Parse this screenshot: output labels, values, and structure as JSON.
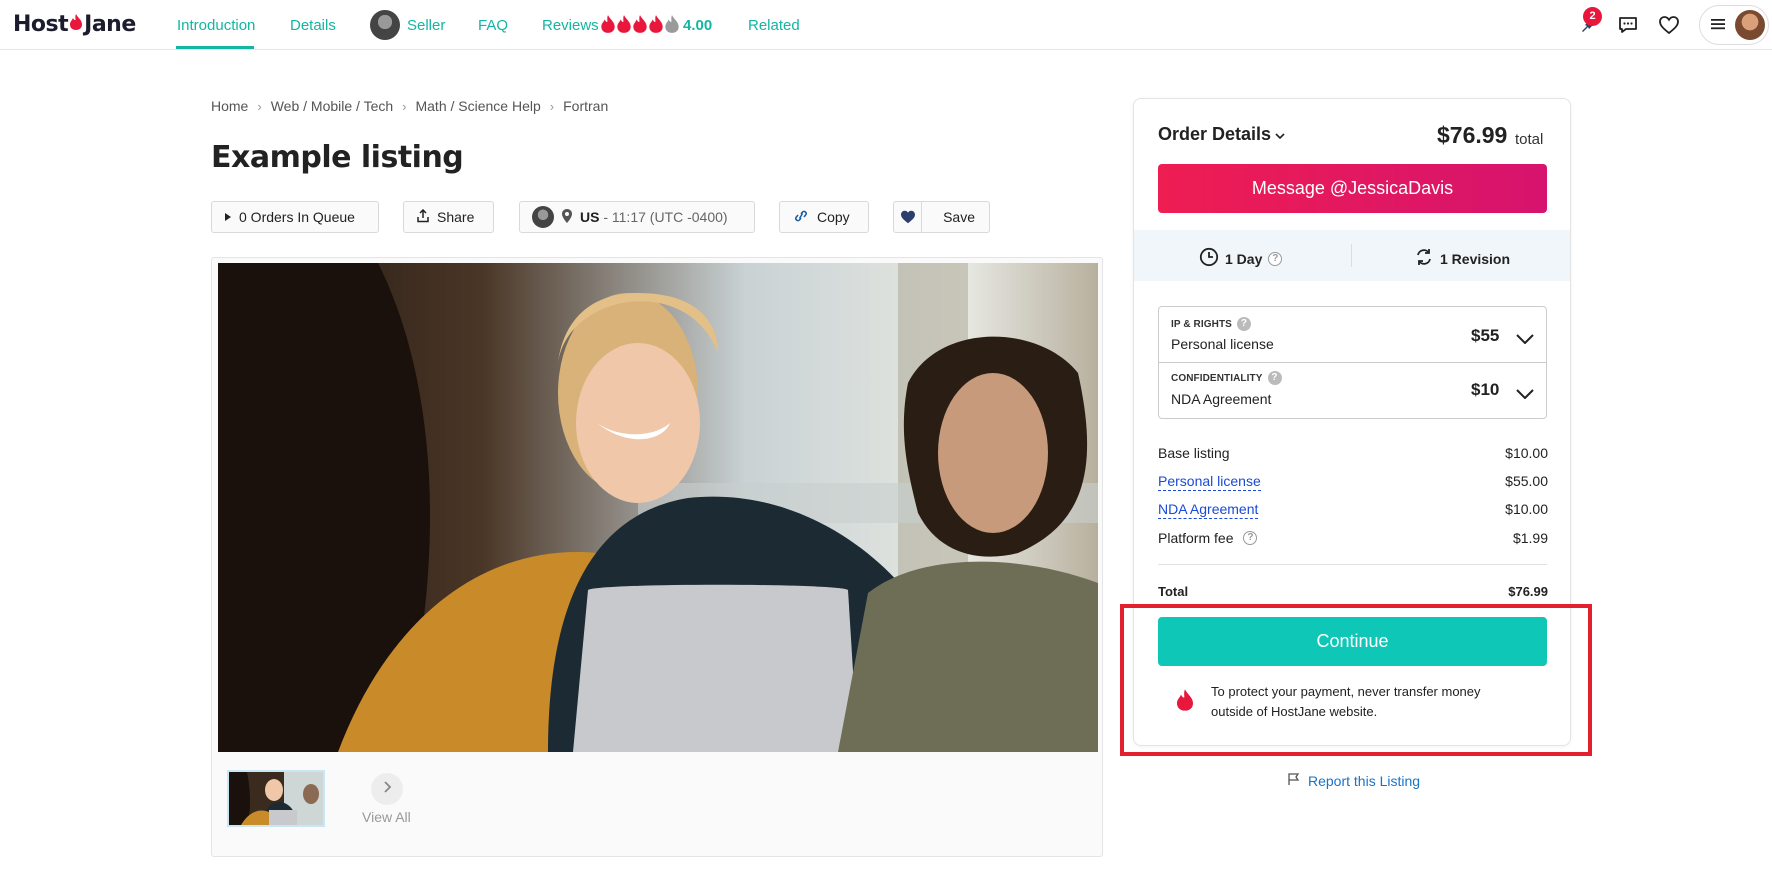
{
  "brand": {
    "part1": "Host",
    "part2": "Jane",
    "accent": "#e8173b",
    "teal": "#13b5a3"
  },
  "nav": {
    "introduction": "Introduction",
    "details": "Details",
    "seller": "Seller",
    "faq": "FAQ",
    "reviews": "Reviews",
    "rating": "4.00",
    "related": "Related",
    "notification_count": "2"
  },
  "breadcrumb": [
    "Home",
    "Web / Mobile / Tech",
    "Math / Science Help",
    "Fortran"
  ],
  "listing": {
    "title": "Example listing",
    "orders_in_queue": "0 Orders In Queue",
    "share": "Share",
    "country": "US",
    "time": "- 11:17 (UTC -0400)",
    "copy": "Copy",
    "save": "Save",
    "view_all": "View All"
  },
  "order": {
    "title": "Order Details",
    "price": "$76.99",
    "price_suffix": "total",
    "message_button": "Message @JessicaDavis",
    "delivery": "1 Day",
    "revisions": "1 Revision",
    "ip_label": "IP & RIGHTS",
    "ip_value": "Personal license",
    "ip_price": "$55",
    "conf_label": "CONFIDENTIALITY",
    "conf_value": "NDA Agreement",
    "conf_price": "$10",
    "lines": [
      {
        "label": "Base listing",
        "amount": "$10.00"
      },
      {
        "label": "Personal license",
        "amount": "$55.00"
      },
      {
        "label": "NDA Agreement",
        "amount": "$10.00"
      },
      {
        "label": "Platform fee",
        "amount": "$1.99"
      }
    ],
    "total_label": "Total",
    "total_amount": "$76.99",
    "continue": "Continue",
    "protect_text": "To protect your payment, never transfer money outside of HostJane website.",
    "report": "Report this Listing"
  }
}
